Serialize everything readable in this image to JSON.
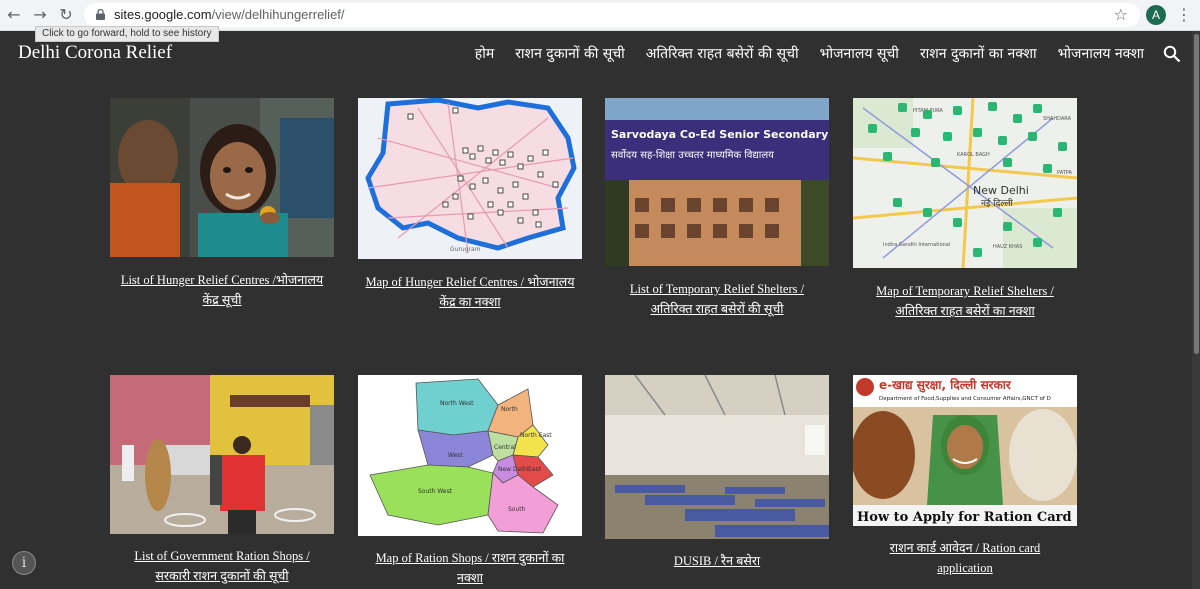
{
  "browser": {
    "url_host": "sites.google.com",
    "url_path": "/view/delhihungerrelief/",
    "tooltip": "Click to go forward, hold to see history",
    "avatar_letter": "A"
  },
  "site": {
    "title": "Delhi Corona Relief",
    "nav": [
      "होम",
      "राशन दुकानों की सूची",
      "अतिरिक्त राहत बसेरों की सूची",
      "भोजनालय सूची",
      "राशन दुकानों का नक्शा",
      "भोजनालय नक्शा"
    ]
  },
  "cards": [
    {
      "line1": "List of Hunger Relief Centres /भोजनालय",
      "line2": "केंद्र सूची"
    },
    {
      "line1": "Map of Hunger Relief Centres / भोजनालय",
      "line2": "केंद्र का नक्शा"
    },
    {
      "line1": "List of Temporary Relief Shelters /",
      "line2": "अतिरिक्त राहत बसेरों की सूची"
    },
    {
      "line1": "Map of Temporary Relief Shelters /",
      "line2": "अतिरिक्त राहत बसेरों का नक्शा"
    },
    {
      "line1": "List of Government Ration Shops /",
      "line2": "सरकारी राशन दुकानों की सूची"
    },
    {
      "line1": "Map of Ration Shops / राशन दुकानों का",
      "line2": "नक्शा"
    },
    {
      "line1": "DUSIB / रैन बसेरा",
      "line2": ""
    },
    {
      "line1": "राशन कार्ड आवेदन / Ration card",
      "line2": "application"
    }
  ],
  "image_text": {
    "school_sign": "Sarvodaya Co-Ed Senior Secondary School",
    "school_sign_hindi": "सर्वोदय सह-शिक्षा उच्चतर माध्यमिक विद्यालय",
    "map_city": "New Delhi",
    "map_city_hindi": "नई दिल्ली",
    "map_labels": [
      "KAROL BAGH",
      "SHAHDARA",
      "HAUZ KHAS",
      "PATPA",
      "PITAM PURA",
      "Indira Gandhi International"
    ],
    "district_labels": [
      "North West",
      "North",
      "North East",
      "West",
      "Central",
      "New Delhi",
      "East",
      "South West",
      "South"
    ],
    "ration_banner_hindi": "e-खाद्य सुरक्षा, दिल्ली सरकार",
    "ration_banner_dept": "Department of Food,Supplies and Consumer Affairs,GNCT of D",
    "ration_banner_foot": "How to Apply for Ration Card",
    "gurugram_label": "Gurugram"
  }
}
